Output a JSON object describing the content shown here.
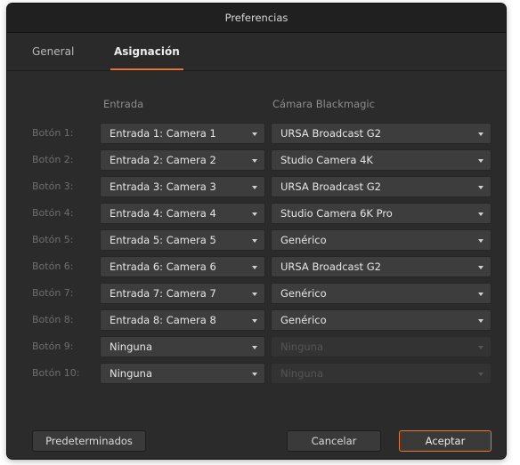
{
  "window": {
    "title": "Preferencias"
  },
  "tabs": [
    {
      "label": "General",
      "active": false
    },
    {
      "label": "Asignación",
      "active": true
    }
  ],
  "columns": {
    "input": "Entrada",
    "camera": "Cámara Blackmagic"
  },
  "rows": [
    {
      "label": "Botón 1:",
      "input": "Entrada 1: Camera 1",
      "camera": "URSA Broadcast G2",
      "camera_enabled": true
    },
    {
      "label": "Botón 2:",
      "input": "Entrada 2: Camera 2",
      "camera": "Studio Camera 4K",
      "camera_enabled": true
    },
    {
      "label": "Botón 3:",
      "input": "Entrada 3: Camera 3",
      "camera": "URSA Broadcast G2",
      "camera_enabled": true
    },
    {
      "label": "Botón 4:",
      "input": "Entrada 4: Camera 4",
      "camera": "Studio Camera 6K Pro",
      "camera_enabled": true
    },
    {
      "label": "Botón 5:",
      "input": "Entrada 5: Camera 5",
      "camera": "Genérico",
      "camera_enabled": true
    },
    {
      "label": "Botón 6:",
      "input": "Entrada 6: Camera 6",
      "camera": "URSA Broadcast G2",
      "camera_enabled": true
    },
    {
      "label": "Botón 7:",
      "input": "Entrada 7: Camera 7",
      "camera": "Genérico",
      "camera_enabled": true
    },
    {
      "label": "Botón 8:",
      "input": "Entrada 8: Camera 8",
      "camera": "Genérico",
      "camera_enabled": true
    },
    {
      "label": "Botón 9:",
      "input": "Ninguna",
      "camera": "Ninguna",
      "camera_enabled": false
    },
    {
      "label": "Botón 10:",
      "input": "Ninguna",
      "camera": "Ninguna",
      "camera_enabled": false
    }
  ],
  "buttons": {
    "defaults": "Predeterminados",
    "cancel": "Cancelar",
    "accept": "Aceptar"
  },
  "colors": {
    "accent": "#e8762b",
    "background": "#2b2b2b"
  }
}
